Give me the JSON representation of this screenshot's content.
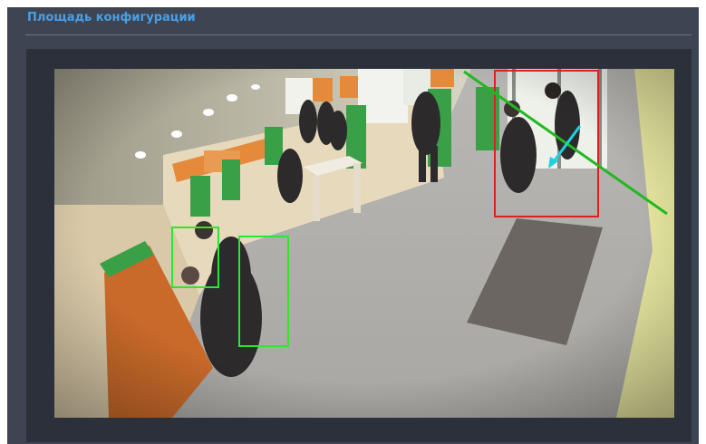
{
  "panel": {
    "title": "Площадь конфигурации"
  },
  "video": {
    "description_icon": "camera-feed",
    "detections": {
      "tracked_color": "#2ee62e",
      "alert_color": "#e02020",
      "line_color": "#22b822",
      "arrow_color": "#1fd0e0"
    }
  }
}
